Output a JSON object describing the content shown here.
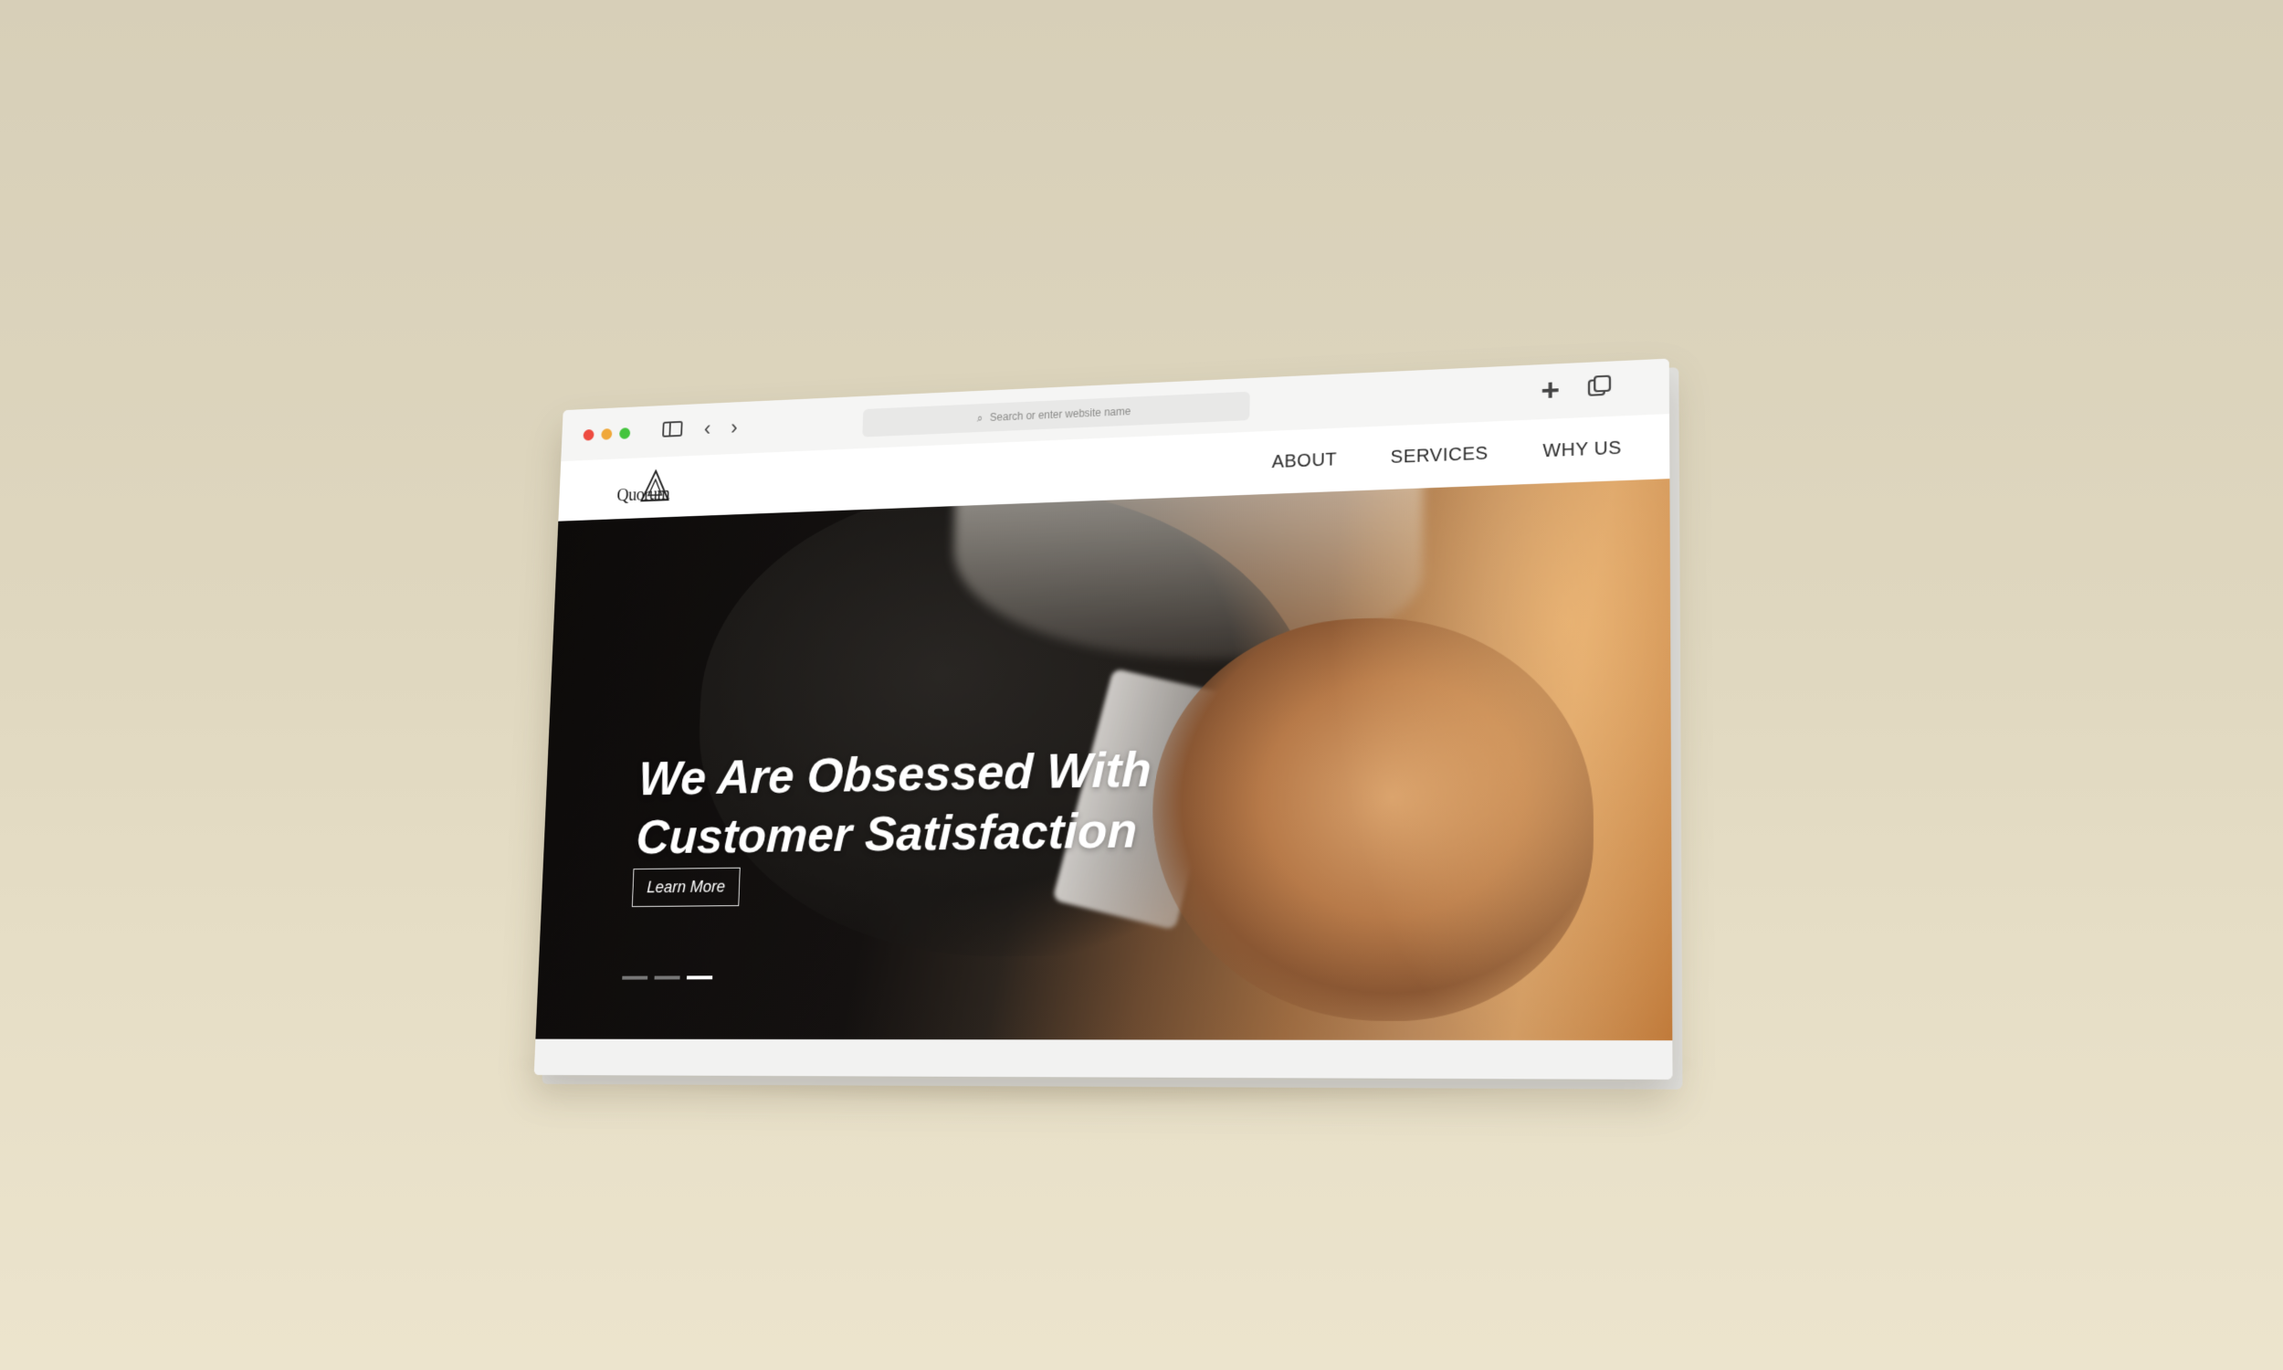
{
  "browser": {
    "address_placeholder": "Search or enter website name",
    "controls": [
      "close",
      "minimize",
      "maximize"
    ],
    "icons": [
      "sidebar-icon",
      "back-icon",
      "forward-icon",
      "search-icon",
      "plus-icon",
      "tabs-icon"
    ]
  },
  "site": {
    "logo_text": "Quorum",
    "nav": [
      "ABOUT",
      "SERVICES",
      "WHY US"
    ],
    "hero": {
      "headline_line1": "We Are Obsessed With",
      "headline_line2": "Customer Satisfaction",
      "cta": "Learn More",
      "slides": 3,
      "active_slide": 3
    }
  },
  "colors": {
    "background": "#dfd7bf",
    "hero_dark": "#141110",
    "accent_warm": "#c07a3a"
  }
}
